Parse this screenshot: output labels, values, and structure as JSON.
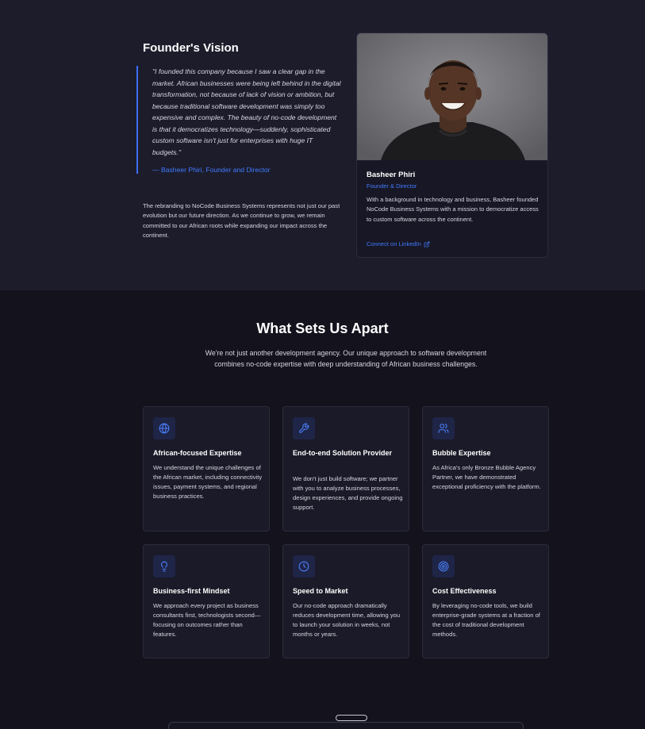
{
  "founder": {
    "title": "Founder's Vision",
    "quote": "\"I founded this company because I saw a clear gap in the market. African businesses were being left behind in the digital transformation, not because of lack of vision or ambition, but because traditional software development was simply too expensive and complex. The beauty of no-code development is that it democratizes technology—suddenly, sophisticated custom software isn't just for enterprises with huge IT budgets.\"",
    "quote_author": "— Basheer Phiri, Founder and Director",
    "rebrand": "The rebranding to NoCode Business Systems represents not just our past evolution but our future direction. As we continue to grow, we remain committed to our African roots while expanding our impact across the continent."
  },
  "profile": {
    "name": "Basheer Phiri",
    "role": "Founder & Director",
    "bio": "With a background in technology and business, Basheer founded NoCode Business Systems with a mission to democratize access to custom software across the continent.",
    "link": "Connect on LinkedIn",
    "link_icon": "external-link-icon"
  },
  "sets_apart": {
    "title": "What Sets Us Apart",
    "subtitle": "We're not just another development agency. Our unique approach to software development combines no-code expertise with deep understanding of African business challenges.",
    "features": [
      {
        "icon": "globe-icon",
        "title": "African-focused Expertise",
        "desc": "We understand the unique challenges of the African market, including connectivity issues, payment systems, and regional business practices."
      },
      {
        "icon": "wrench-icon",
        "title": "End-to-end Solution Provider",
        "desc": "We don't just build software; we partner with you to analyze business processes, design experiences, and provide ongoing support."
      },
      {
        "icon": "users-icon",
        "title": "Bubble Expertise",
        "desc": "As Africa's only Bronze Bubble Agency Partner, we have demonstrated exceptional proficiency with the platform."
      },
      {
        "icon": "lightbulb-icon",
        "title": "Business-first Mindset",
        "desc": "We approach every project as business consultants first, technologists second—focusing on outcomes rather than features."
      },
      {
        "icon": "clock-icon",
        "title": "Speed to Market",
        "desc": "Our no-code approach dramatically reduces development time, allowing you to launch your solution in weeks, not months or years."
      },
      {
        "icon": "target-icon",
        "title": "Cost Effectiveness",
        "desc": "By leveraging no-code tools, we build enterprise-grade systems at a fraction of the cost of traditional development methods."
      }
    ]
  },
  "colors": {
    "accent": "#3f7bff",
    "icon_bg": "#1f2547",
    "card_bg": "#1b1a28",
    "page_bg": "#13121d",
    "section_bg": "#1d1c2b"
  }
}
